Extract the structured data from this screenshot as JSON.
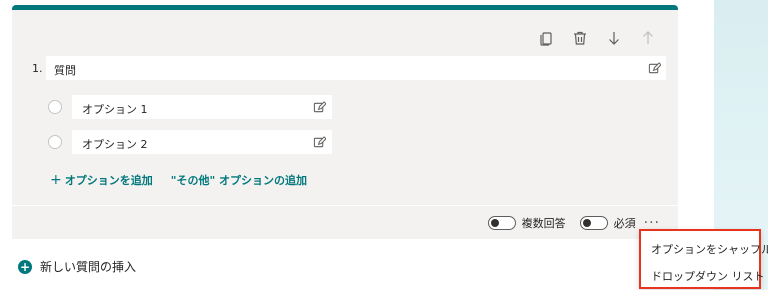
{
  "colors": {
    "accent": "#03787c",
    "card_bg": "#f3f2f1",
    "menu_highlight_border": "#e8341c"
  },
  "toolbar": {
    "copy_icon": "copy-icon",
    "delete_icon": "trash-icon",
    "move_down_icon": "arrow-down-icon",
    "move_up_icon": "arrow-up-icon"
  },
  "question": {
    "number": "1.",
    "text": "質問"
  },
  "options": [
    {
      "label": "オプション 1"
    },
    {
      "label": "オプション 2"
    }
  ],
  "add": {
    "add_option": "オプションを追加",
    "add_other": "\"その他\" オプションの追加"
  },
  "footer": {
    "multiple_answers": "複数回答",
    "required": "必須",
    "more": "···"
  },
  "insert_new": "新しい質問の挿入",
  "menu": {
    "items": [
      "オプションをシャッフル",
      "ドロップダウン リスト"
    ]
  }
}
